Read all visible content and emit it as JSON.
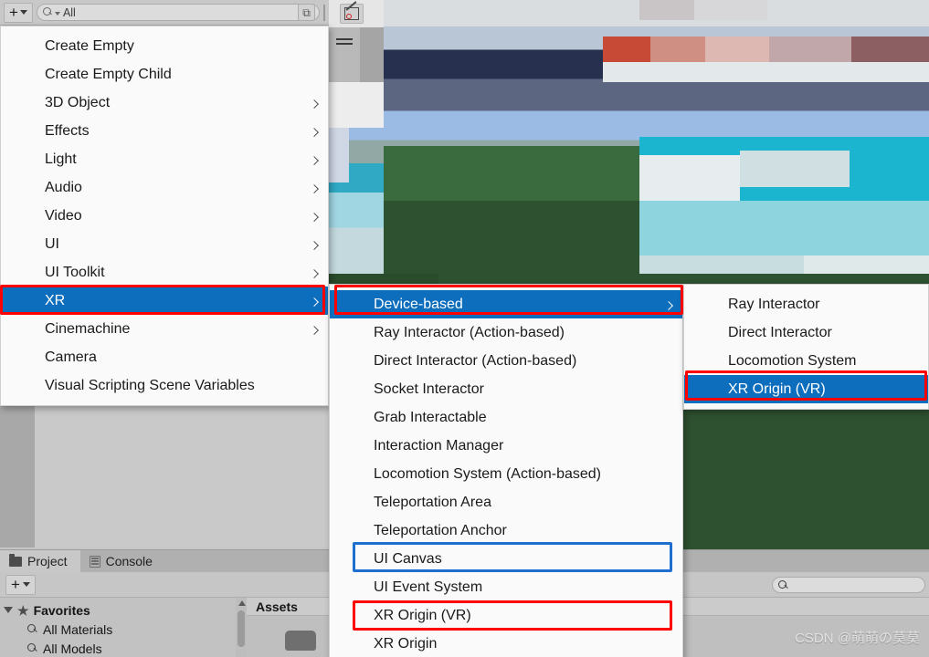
{
  "toolbar": {
    "add_label": "+",
    "search_value": "All",
    "expand_glyph": "⧉"
  },
  "menus": {
    "create_menu": {
      "items": [
        {
          "label": "Create Empty",
          "submenu": false,
          "selected": false
        },
        {
          "label": "Create Empty Child",
          "submenu": false,
          "selected": false
        },
        {
          "label": "3D Object",
          "submenu": true,
          "selected": false
        },
        {
          "label": "Effects",
          "submenu": true,
          "selected": false
        },
        {
          "label": "Light",
          "submenu": true,
          "selected": false
        },
        {
          "label": "Audio",
          "submenu": true,
          "selected": false
        },
        {
          "label": "Video",
          "submenu": true,
          "selected": false
        },
        {
          "label": "UI",
          "submenu": true,
          "selected": false
        },
        {
          "label": "UI Toolkit",
          "submenu": true,
          "selected": false
        },
        {
          "label": "XR",
          "submenu": true,
          "selected": true
        },
        {
          "label": "Cinemachine",
          "submenu": true,
          "selected": false
        },
        {
          "label": "Camera",
          "submenu": false,
          "selected": false
        },
        {
          "label": "Visual Scripting Scene Variables",
          "submenu": false,
          "selected": false
        }
      ]
    },
    "xr_menu": {
      "items": [
        {
          "label": "Device-based",
          "submenu": true,
          "selected": true
        },
        {
          "label": "Ray Interactor (Action-based)",
          "submenu": false,
          "selected": false
        },
        {
          "label": "Direct Interactor (Action-based)",
          "submenu": false,
          "selected": false
        },
        {
          "label": "Socket Interactor",
          "submenu": false,
          "selected": false
        },
        {
          "label": "Grab Interactable",
          "submenu": false,
          "selected": false
        },
        {
          "label": "Interaction Manager",
          "submenu": false,
          "selected": false
        },
        {
          "label": "Locomotion System (Action-based)",
          "submenu": false,
          "selected": false
        },
        {
          "label": "Teleportation Area",
          "submenu": false,
          "selected": false
        },
        {
          "label": "Teleportation Anchor",
          "submenu": false,
          "selected": false
        },
        {
          "label": "UI Canvas",
          "submenu": false,
          "selected": false
        },
        {
          "label": "UI Event System",
          "submenu": false,
          "selected": false
        },
        {
          "label": "XR Origin (VR)",
          "submenu": false,
          "selected": false
        },
        {
          "label": "XR Origin",
          "submenu": false,
          "selected": false
        }
      ]
    },
    "device_based_menu": {
      "items": [
        {
          "label": "Ray Interactor",
          "submenu": false,
          "selected": false
        },
        {
          "label": "Direct Interactor",
          "submenu": false,
          "selected": false
        },
        {
          "label": "Locomotion System",
          "submenu": false,
          "selected": false
        },
        {
          "label": "XR Origin (VR)",
          "submenu": false,
          "selected": true
        }
      ]
    }
  },
  "annotations": {
    "colors": {
      "red": "#ff0000",
      "blue": "#1f6fd0",
      "highlight": "#0d6ebd"
    }
  },
  "bottom_panel": {
    "tabs": [
      {
        "label": "Project",
        "icon": "folder-icon",
        "active": true
      },
      {
        "label": "Console",
        "icon": "console-icon",
        "active": false
      }
    ],
    "add_label": "+",
    "search_value": "",
    "tree": [
      {
        "label": "Favorites",
        "level": 0,
        "icon": "star-icon"
      },
      {
        "label": "All Materials",
        "level": 1,
        "icon": "search-icon"
      },
      {
        "label": "All Models",
        "level": 1,
        "icon": "search-icon"
      }
    ],
    "assets_header": "Assets"
  },
  "watermark": "CSDN @萌萌の莫莫"
}
